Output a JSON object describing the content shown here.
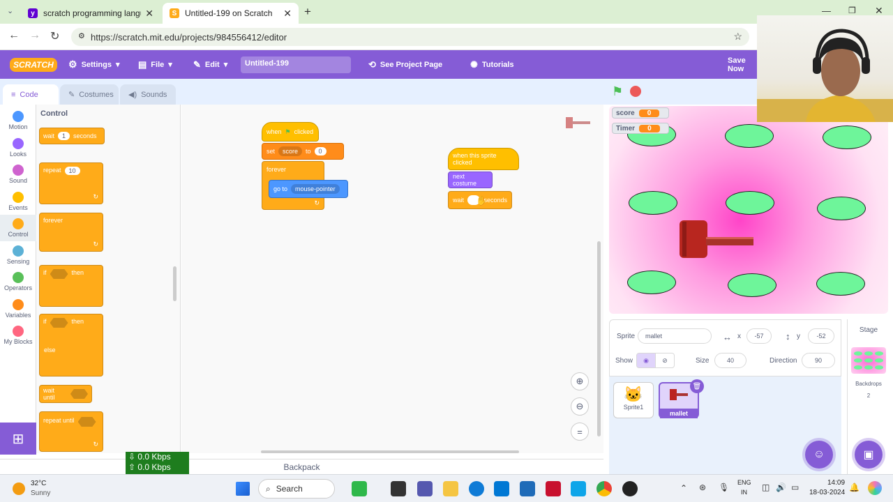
{
  "browser": {
    "tabs": [
      {
        "title": "scratch programming language",
        "favicon": "yahoo-icon"
      },
      {
        "title": "Untitled-199 on Scratch",
        "favicon": "scratch-icon"
      }
    ],
    "url": "https://scratch.mit.edu/projects/984556412/editor"
  },
  "menu": {
    "logo": "SCRATCH",
    "settings": "Settings",
    "file": "File",
    "edit": "Edit",
    "project_title": "Untitled-199",
    "see_project": "See Project Page",
    "tutorials": "Tutorials",
    "save": "Save Now"
  },
  "editor_tabs": {
    "code": "Code",
    "costumes": "Costumes",
    "sounds": "Sounds"
  },
  "categories": [
    {
      "label": "Motion",
      "color": "#4c97ff"
    },
    {
      "label": "Looks",
      "color": "#9966ff"
    },
    {
      "label": "Sound",
      "color": "#cf63cf"
    },
    {
      "label": "Events",
      "color": "#ffbf00"
    },
    {
      "label": "Control",
      "color": "#ffab19"
    },
    {
      "label": "Sensing",
      "color": "#5cb1d6"
    },
    {
      "label": "Operators",
      "color": "#59c059"
    },
    {
      "label": "Variables",
      "color": "#ff8c1a"
    },
    {
      "label": "My Blocks",
      "color": "#ff6680"
    }
  ],
  "palette": {
    "heading": "Control",
    "wait": "wait",
    "wait_val": "1",
    "seconds": "seconds",
    "repeat": "repeat",
    "repeat_val": "10",
    "forever": "forever",
    "if": "if",
    "then": "then",
    "else": "else",
    "wait_until": "wait until",
    "repeat_until": "repeat until"
  },
  "script1": {
    "when": "when",
    "clicked": "clicked",
    "set": "set",
    "var": "score",
    "to": "to",
    "to_val": "0",
    "forever": "forever",
    "goto": "go to",
    "target": "mouse-pointer"
  },
  "script2": {
    "hat": "when this sprite clicked",
    "next_costume": "next costume",
    "wait": "wait",
    "seconds": "seconds"
  },
  "monitors": [
    {
      "name": "score",
      "value": "0"
    },
    {
      "name": "Timer",
      "value": "0"
    }
  ],
  "sprite_info": {
    "sprite_label": "Sprite",
    "sprite_name": "mallet",
    "x_label": "x",
    "x": "-57",
    "y_label": "y",
    "y": "-52",
    "show_label": "Show",
    "size_label": "Size",
    "size": "40",
    "direction_label": "Direction",
    "direction": "90"
  },
  "sprites": [
    {
      "name": "Sprite1",
      "selected": false
    },
    {
      "name": "mallet",
      "selected": true
    }
  ],
  "stage_pane": {
    "title": "Stage",
    "backdrops_label": "Backdrops",
    "backdrops": "2"
  },
  "backpack": "Backpack",
  "network": {
    "down": "0.0 Kbps",
    "up": "0.0 Kbps"
  },
  "taskbar": {
    "temp": "32°C",
    "weather": "Sunny",
    "search": "Search",
    "lang1": "ENG",
    "lang2": "IN",
    "time": "14:09",
    "date": "18-03-2024"
  }
}
